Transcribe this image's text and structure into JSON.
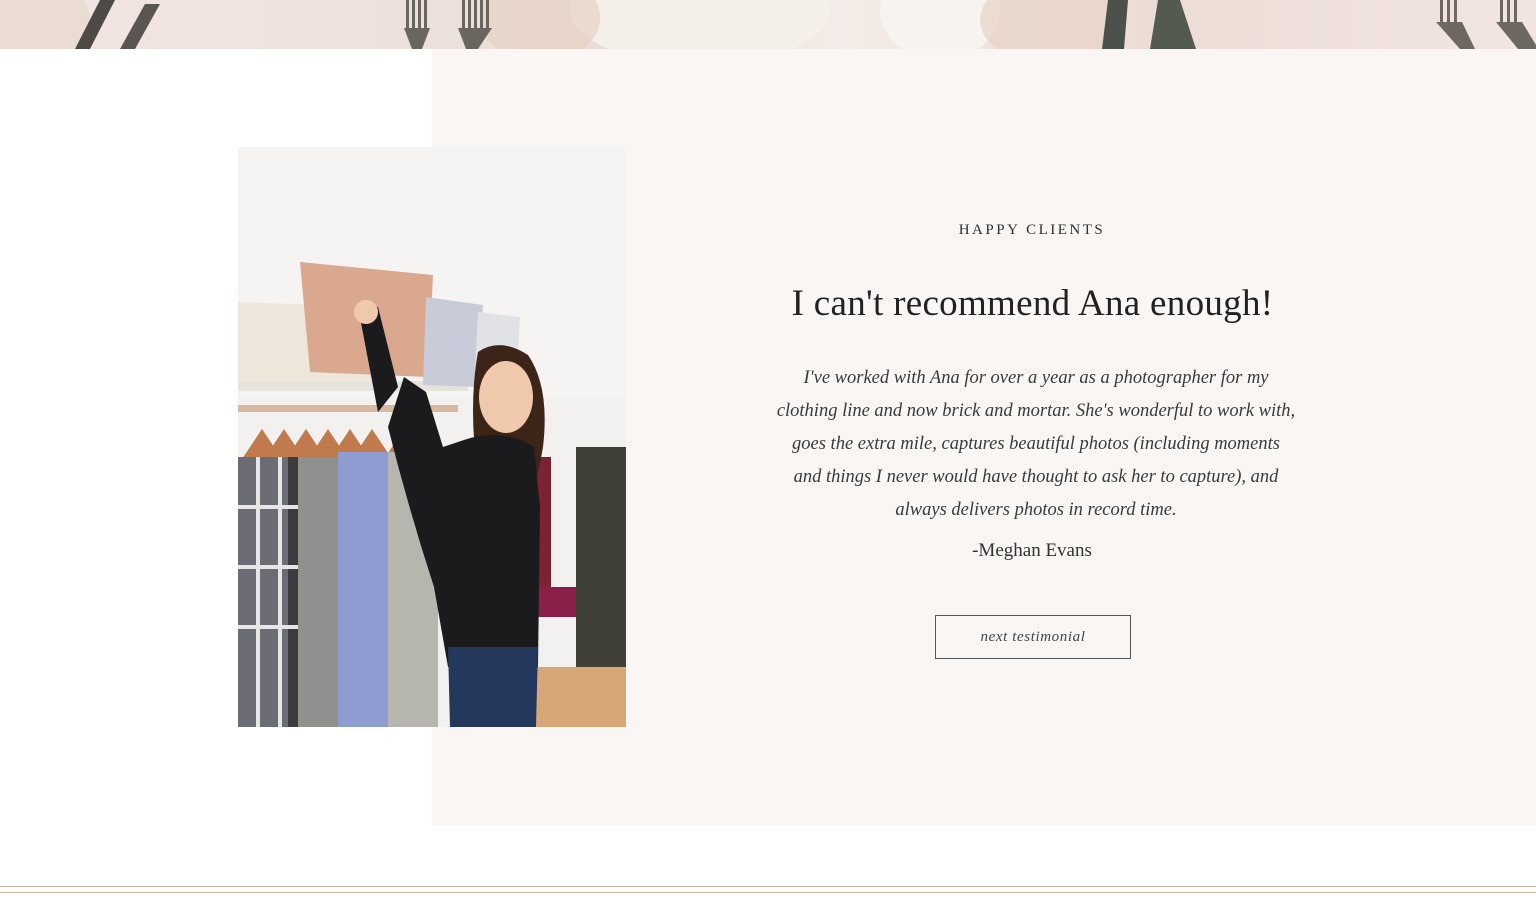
{
  "testimonial": {
    "eyebrow": "HAPPY CLIENTS",
    "headline": "I can't recommend Ana enough!",
    "quote": "I've worked with Ana for over a year as a photographer for my clothing line and now brick and mortar. She's wonderful to work with, goes the extra mile, captures beautiful photos (including moments and things I never would have thought to ask her to capture), and always delivers photos in record time.",
    "author": "-Meghan Evans",
    "next_label": "next testimonial"
  },
  "colors": {
    "panel_bg": "#f9f6f3",
    "divider": "#cdb89f",
    "text": "#2b2b2b"
  }
}
